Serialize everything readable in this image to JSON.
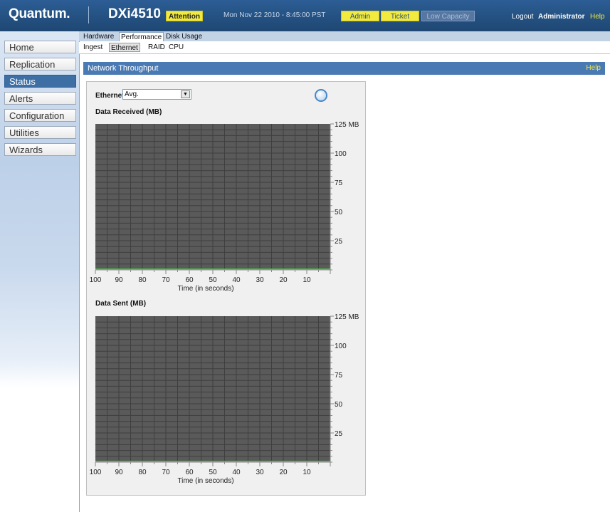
{
  "header": {
    "logo": "Quantum.",
    "model": "DXi4510",
    "attention": "Attention",
    "datetime": "Mon Nov 22 2010 - 8:45:00 PST",
    "admin": "Admin",
    "ticket": "Ticket",
    "low_capacity": "Low Capacity",
    "logout": "Logout",
    "user": "Administrator",
    "help": "Help"
  },
  "sidebar": {
    "items": [
      {
        "label": "Home"
      },
      {
        "label": "Replication"
      },
      {
        "label": "Status"
      },
      {
        "label": "Alerts"
      },
      {
        "label": "Configuration"
      },
      {
        "label": "Utilities"
      },
      {
        "label": "Wizards"
      }
    ]
  },
  "tabs_primary": [
    "Hardware",
    "Performance",
    "Disk Usage"
  ],
  "tabs_secondary": [
    "Ingest",
    "Ethernet",
    "RAID",
    "CPU"
  ],
  "section": {
    "title": "Network Throughput",
    "help": "Help"
  },
  "controls": {
    "ethernet_label": "Ethernet",
    "ethernet_value": "Avg."
  },
  "colors": {
    "header": "#23507f",
    "accent_yellow": "#f2ea3f",
    "chart_bg": "#5a5a5a",
    "section_bar": "#4a7ab3"
  },
  "chart_data": [
    {
      "type": "line",
      "title": "Data Received (MB)",
      "xlabel": "Time (in seconds)",
      "x_ticks": [
        "100",
        "90",
        "80",
        "70",
        "60",
        "50",
        "40",
        "30",
        "20",
        "10"
      ],
      "y_ticks": [
        "125 MB",
        "100",
        "75",
        "50",
        "25"
      ],
      "ylim": [
        0,
        125
      ],
      "x": [
        100,
        90,
        80,
        70,
        60,
        50,
        40,
        30,
        20,
        10,
        0
      ],
      "series": [
        {
          "values": [
            0,
            0,
            0,
            0,
            0,
            0,
            0,
            0,
            0,
            0,
            0
          ]
        }
      ]
    },
    {
      "type": "line",
      "title": "Data Sent (MB)",
      "xlabel": "Time (in seconds)",
      "x_ticks": [
        "100",
        "90",
        "80",
        "70",
        "60",
        "50",
        "40",
        "30",
        "20",
        "10"
      ],
      "y_ticks": [
        "125 MB",
        "100",
        "75",
        "50",
        "25"
      ],
      "ylim": [
        0,
        125
      ],
      "x": [
        100,
        90,
        80,
        70,
        60,
        50,
        40,
        30,
        20,
        10,
        0
      ],
      "series": [
        {
          "values": [
            0,
            0,
            0,
            0,
            0,
            0,
            0,
            0,
            0,
            0,
            0
          ]
        }
      ]
    }
  ]
}
